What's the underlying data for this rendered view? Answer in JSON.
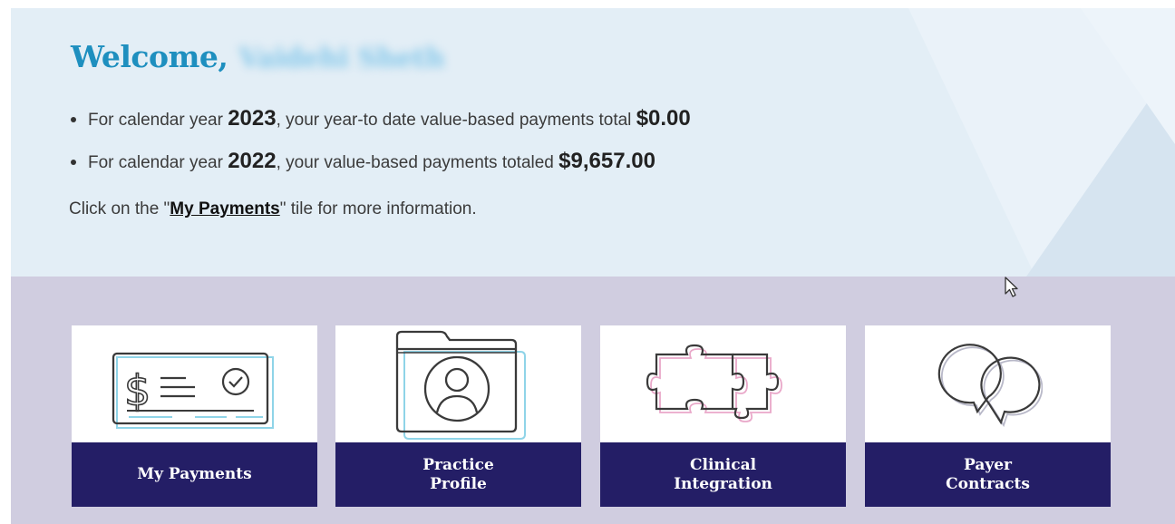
{
  "welcome": {
    "greeting": "Welcome,",
    "user_name": "Vaidehi Sheth"
  },
  "payments": [
    {
      "prefix": "For calendar year ",
      "year": "2023",
      "middle": ", your year-to date value-based payments total ",
      "amount": "$0.00"
    },
    {
      "prefix": "For calendar year ",
      "year": "2022",
      "middle": ", your value-based payments totaled ",
      "amount": "$9,657.00"
    }
  ],
  "note": {
    "before": "Click on the \"",
    "link": "My Payments",
    "after": "\" tile for more information."
  },
  "tiles": [
    {
      "label": "My Payments",
      "icon": "check-payment-icon"
    },
    {
      "label": "Practice Profile",
      "icon": "folder-profile-icon"
    },
    {
      "label": "Clinical Integration",
      "icon": "puzzle-icon"
    },
    {
      "label": "Payer Contracts",
      "icon": "chat-bubbles-icon"
    }
  ],
  "colors": {
    "hero_bg": "#e3eef6",
    "band_bg": "#d0cde0",
    "tile_label_bg": "#241e66",
    "welcome_text": "#1e8fbf"
  }
}
